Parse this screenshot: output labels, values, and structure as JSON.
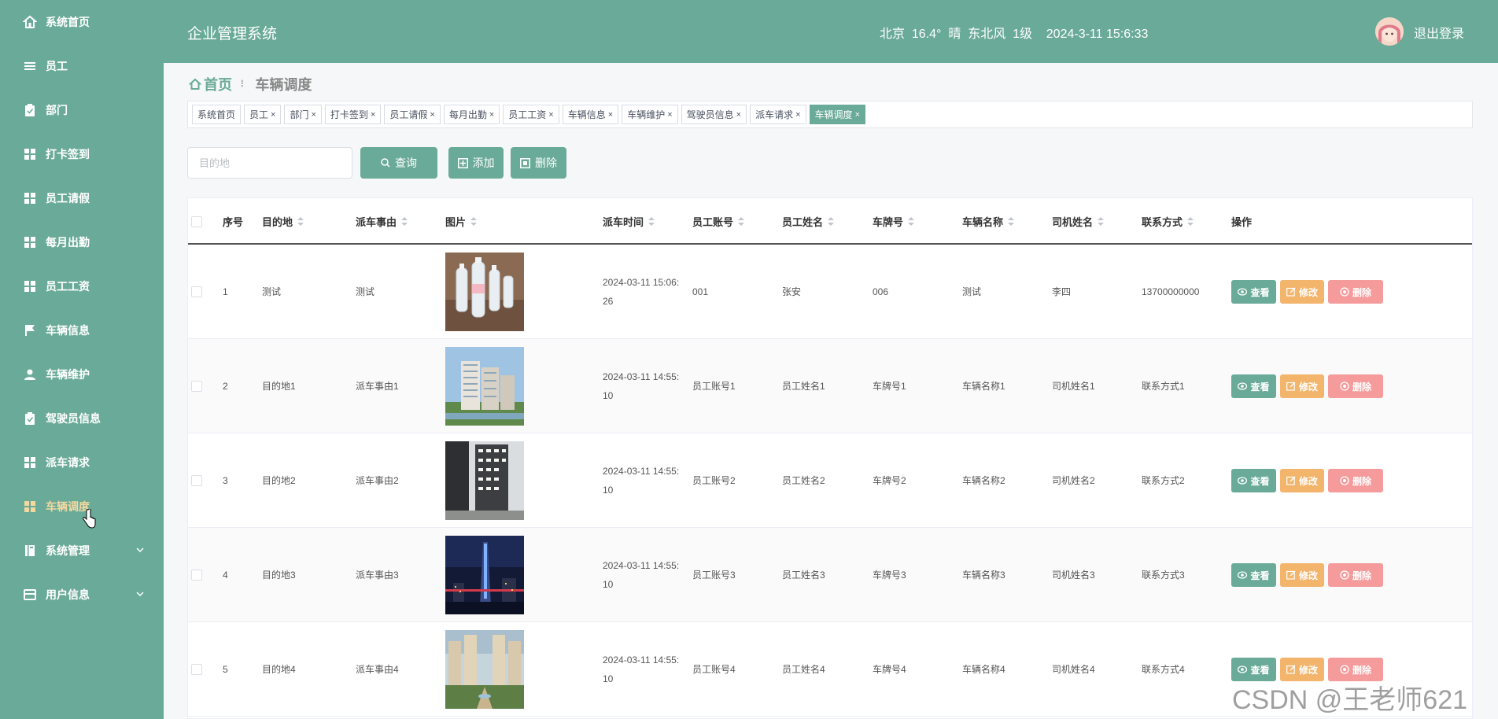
{
  "sidebar": {
    "items": [
      {
        "label": "系统首页",
        "icon": "home-icon"
      },
      {
        "label": "员工",
        "icon": "list-icon"
      },
      {
        "label": "部门",
        "icon": "clipboard-icon"
      },
      {
        "label": "打卡签到",
        "icon": "grid-icon"
      },
      {
        "label": "员工请假",
        "icon": "grid-icon"
      },
      {
        "label": "每月出勤",
        "icon": "grid-icon"
      },
      {
        "label": "员工工资",
        "icon": "grid-icon"
      },
      {
        "label": "车辆信息",
        "icon": "flag-icon"
      },
      {
        "label": "车辆维护",
        "icon": "user-icon"
      },
      {
        "label": "驾驶员信息",
        "icon": "clipboard-icon"
      },
      {
        "label": "派车请求",
        "icon": "grid-icon"
      },
      {
        "label": "车辆调度",
        "icon": "grid-icon",
        "active": true
      },
      {
        "label": "系统管理",
        "icon": "book-icon",
        "expandable": true
      },
      {
        "label": "用户信息",
        "icon": "card-icon",
        "expandable": true
      }
    ]
  },
  "header": {
    "title": "企业管理系统",
    "weather": "北京  16.4°  晴  东北风  1级    2024-3-11 15:6:33",
    "logout": "退出登录"
  },
  "breadcrumb": {
    "home": "首页",
    "current": "车辆调度"
  },
  "tags": [
    "系统首页",
    "员工",
    "部门",
    "打卡签到",
    "员工请假",
    "每月出勤",
    "员工工资",
    "车辆信息",
    "车辆维护",
    "驾驶员信息",
    "派车请求",
    "车辆调度"
  ],
  "search": {
    "placeholder": "目的地",
    "query_label": "查询",
    "add_label": "添加",
    "delete_label": "删除"
  },
  "table": {
    "columns": [
      "序号",
      "目的地",
      "派车事由",
      "图片",
      "派车时间",
      "员工账号",
      "员工姓名",
      "车牌号",
      "车辆名称",
      "司机姓名",
      "联系方式",
      "操作"
    ],
    "rows": [
      {
        "no": "1",
        "dest": "测试",
        "reason": "测试",
        "image": "water-bottles",
        "time_a": "2024-03-11 15:06:",
        "time_b": "26",
        "account": "001",
        "name": "张安",
        "plate": "006",
        "vehicle": "测试",
        "driver": "李四",
        "contact": "13700000000"
      },
      {
        "no": "2",
        "dest": "目的地1",
        "reason": "派车事由1",
        "image": "apartment-blocks",
        "time_a": "2024-03-11 14:55:",
        "time_b": "10",
        "account": "员工账号1",
        "name": "员工姓名1",
        "plate": "车牌号1",
        "vehicle": "车辆名称1",
        "driver": "司机姓名1",
        "contact": "联系方式1"
      },
      {
        "no": "3",
        "dest": "目的地2",
        "reason": "派车事由2",
        "image": "office-tower",
        "time_a": "2024-03-11 14:55:",
        "time_b": "10",
        "account": "员工账号2",
        "name": "员工姓名2",
        "plate": "车牌号2",
        "vehicle": "车辆名称2",
        "driver": "司机姓名2",
        "contact": "联系方式2"
      },
      {
        "no": "4",
        "dest": "目的地3",
        "reason": "派车事由3",
        "image": "night-skyscraper",
        "time_a": "2024-03-11 14:55:",
        "time_b": "10",
        "account": "员工账号3",
        "name": "员工姓名3",
        "plate": "车牌号3",
        "vehicle": "车辆名称3",
        "driver": "司机姓名3",
        "contact": "联系方式3"
      },
      {
        "no": "5",
        "dest": "目的地4",
        "reason": "派车事由4",
        "image": "residential-complex",
        "time_a": "2024-03-11 14:55:",
        "time_b": "10",
        "account": "员工账号4",
        "name": "员工姓名4",
        "plate": "车牌号4",
        "vehicle": "车辆名称4",
        "driver": "司机姓名4",
        "contact": "联系方式4"
      }
    ],
    "actions": {
      "view": "查看",
      "edit": "修改",
      "delete": "删除"
    }
  },
  "watermark": "CSDN @王老师621",
  "colors": {
    "primary": "#6aaa98",
    "edit": "#f3b46b",
    "delete": "#f59b9b",
    "active_menu": "#f3d9a0"
  }
}
